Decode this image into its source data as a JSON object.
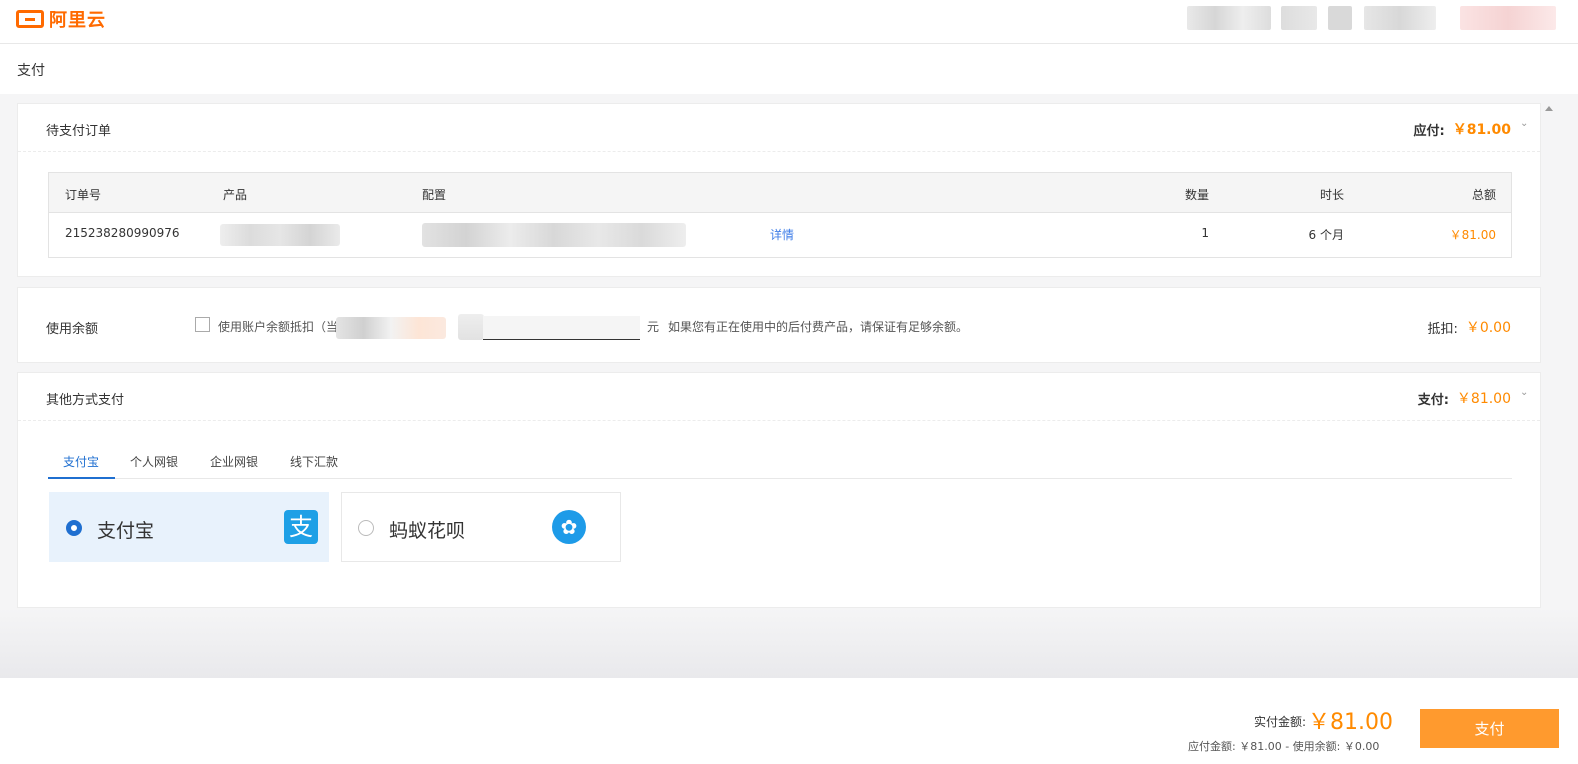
{
  "brand": {
    "name": "阿里云",
    "color": "#ff6a00"
  },
  "page": {
    "title": "支付"
  },
  "order_section": {
    "title": "待支付订单",
    "payable_label": "应付:",
    "payable_amount": "￥81.00",
    "columns": [
      "订单号",
      "产品",
      "配置",
      "数量",
      "时长",
      "总额"
    ],
    "rows": [
      {
        "order_no": "215238280990976",
        "detail_link": "详情",
        "qty": "1",
        "duration": "6 个月",
        "total": "￥81.00"
      }
    ]
  },
  "balance_section": {
    "title": "使用余额",
    "checkbox_label": "使用账户余额抵扣（当",
    "unit": "元",
    "note": "如果您有正在使用中的后付费产品，请保证有足够余额。",
    "deduct_label": "抵扣:",
    "deduct_amount": "￥0.00"
  },
  "other_payment": {
    "title": "其他方式支付",
    "pay_label": "支付:",
    "pay_amount": "￥81.00",
    "tabs": [
      "支付宝",
      "个人网银",
      "企业网银",
      "线下汇款"
    ],
    "active_tab": "支付宝",
    "options": [
      {
        "label": "支付宝",
        "selected": true,
        "icon": "alipay-icon"
      },
      {
        "label": "蚂蚁花呗",
        "selected": false,
        "icon": "huabei-icon"
      }
    ]
  },
  "footer": {
    "actual_label": "实付金额:",
    "actual_amount": "￥81.00",
    "breakdown": "应付金额: ￥81.00 - 使用余额: ￥0.00",
    "pay_button": "支付"
  },
  "colors": {
    "accent": "#ff8a00",
    "link": "#3f7ee8",
    "tab_active": "#1f6fd0",
    "pay_button": "#ff9a2e"
  }
}
